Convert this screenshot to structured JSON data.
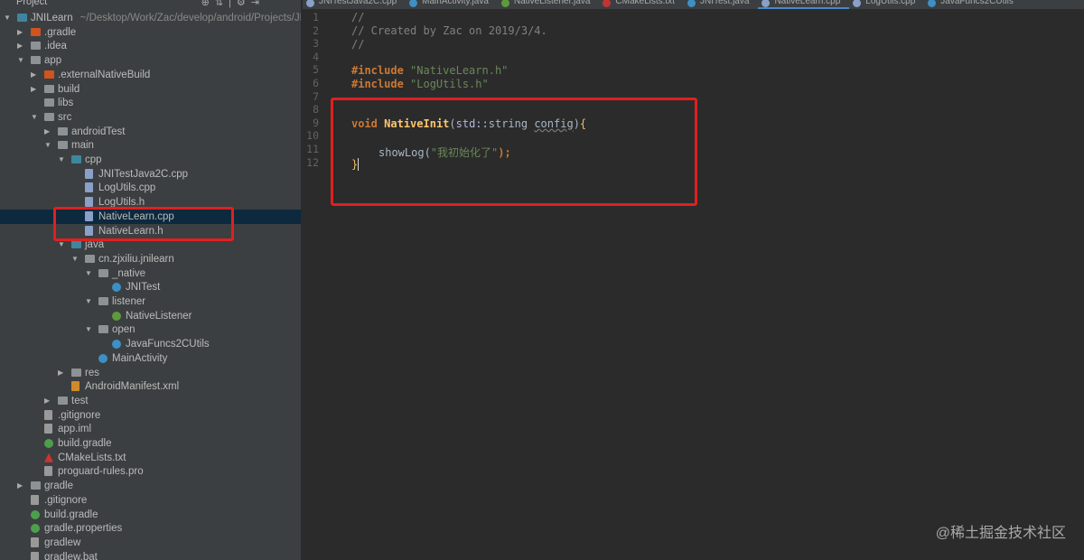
{
  "sidebar": {
    "title": "Project",
    "tree": [
      {
        "label": "JNILearn",
        "path": "~/Desktop/Work/Zac/develop/android/Projects/JN",
        "level": 0,
        "arrow": "down",
        "icon": "module"
      },
      {
        "label": ".gradle",
        "level": 1,
        "arrow": "right",
        "icon": "folder-orange"
      },
      {
        "label": ".idea",
        "level": 1,
        "arrow": "right",
        "icon": "folder"
      },
      {
        "label": "app",
        "level": 1,
        "arrow": "down",
        "icon": "folder"
      },
      {
        "label": ".externalNativeBuild",
        "level": 2,
        "arrow": "right",
        "icon": "folder-orange"
      },
      {
        "label": "build",
        "level": 2,
        "arrow": "right",
        "icon": "folder"
      },
      {
        "label": "libs",
        "level": 2,
        "arrow": "",
        "icon": "folder"
      },
      {
        "label": "src",
        "level": 2,
        "arrow": "down",
        "icon": "folder"
      },
      {
        "label": "androidTest",
        "level": 3,
        "arrow": "right",
        "icon": "folder"
      },
      {
        "label": "main",
        "level": 3,
        "arrow": "down",
        "icon": "folder"
      },
      {
        "label": "cpp",
        "level": 4,
        "arrow": "down",
        "icon": "folder-blue"
      },
      {
        "label": "JNITestJava2C.cpp",
        "level": 5,
        "arrow": "",
        "icon": "file"
      },
      {
        "label": "LogUtils.cpp",
        "level": 5,
        "arrow": "",
        "icon": "file"
      },
      {
        "label": "LogUtils.h",
        "level": 5,
        "arrow": "",
        "icon": "file"
      },
      {
        "label": "NativeLearn.cpp",
        "level": 5,
        "arrow": "",
        "icon": "file",
        "selected": true
      },
      {
        "label": "NativeLearn.h",
        "level": 5,
        "arrow": "",
        "icon": "file"
      },
      {
        "label": "java",
        "level": 4,
        "arrow": "down",
        "icon": "folder-blue"
      },
      {
        "label": "cn.zjxiliu.jnilearn",
        "level": 5,
        "arrow": "down",
        "icon": "folder"
      },
      {
        "label": "_native",
        "level": 6,
        "arrow": "down",
        "icon": "folder"
      },
      {
        "label": "JNITest",
        "level": 7,
        "arrow": "",
        "icon": "class"
      },
      {
        "label": "listener",
        "level": 6,
        "arrow": "down",
        "icon": "folder"
      },
      {
        "label": "NativeListener",
        "level": 7,
        "arrow": "",
        "icon": "interface"
      },
      {
        "label": "open",
        "level": 6,
        "arrow": "down",
        "icon": "folder"
      },
      {
        "label": "JavaFuncs2CUtils",
        "level": 7,
        "arrow": "",
        "icon": "class"
      },
      {
        "label": "MainActivity",
        "level": 6,
        "arrow": "",
        "icon": "class"
      },
      {
        "label": "res",
        "level": 4,
        "arrow": "right",
        "icon": "folder"
      },
      {
        "label": "AndroidManifest.xml",
        "level": 4,
        "arrow": "",
        "icon": "xml"
      },
      {
        "label": "test",
        "level": 3,
        "arrow": "right",
        "icon": "folder"
      },
      {
        "label": ".gitignore",
        "level": 2,
        "arrow": "",
        "icon": "text"
      },
      {
        "label": "app.iml",
        "level": 2,
        "arrow": "",
        "icon": "text"
      },
      {
        "label": "build.gradle",
        "level": 2,
        "arrow": "",
        "icon": "gradle"
      },
      {
        "label": "CMakeLists.txt",
        "level": 2,
        "arrow": "",
        "icon": "cmake"
      },
      {
        "label": "proguard-rules.pro",
        "level": 2,
        "arrow": "",
        "icon": "text"
      },
      {
        "label": "gradle",
        "level": 1,
        "arrow": "right",
        "icon": "folder"
      },
      {
        "label": ".gitignore",
        "level": 1,
        "arrow": "",
        "icon": "text"
      },
      {
        "label": "build.gradle",
        "level": 1,
        "arrow": "",
        "icon": "gradle"
      },
      {
        "label": "gradle.properties",
        "level": 1,
        "arrow": "",
        "icon": "gradle"
      },
      {
        "label": "gradlew",
        "level": 1,
        "arrow": "",
        "icon": "text"
      },
      {
        "label": "gradlew.bat",
        "level": 1,
        "arrow": "",
        "icon": "text"
      }
    ]
  },
  "tabs": [
    {
      "label": "JNITestJava2C.cpp",
      "icon": "file",
      "color": "#8aa0c8"
    },
    {
      "label": "MainActivity.java",
      "icon": "class",
      "color": "#3d8fc4"
    },
    {
      "label": "NativeListener.java",
      "icon": "interface",
      "color": "#5d9b3a"
    },
    {
      "label": "CMakeLists.txt",
      "icon": "cmake",
      "color": "#c33333"
    },
    {
      "label": "JNITest.java",
      "icon": "class",
      "color": "#3d8fc4"
    },
    {
      "label": "NativeLearn.cpp",
      "icon": "file",
      "color": "#8aa0c8",
      "active": true
    },
    {
      "label": "LogUtils.cpp",
      "icon": "file",
      "color": "#8aa0c8"
    },
    {
      "label": "JavaFuncs2CUtils",
      "icon": "class",
      "color": "#3d8fc4"
    }
  ],
  "editor": {
    "line_numbers": [
      "1",
      "2",
      "3",
      "4",
      "5",
      "6",
      "7",
      "8",
      "9",
      "10",
      "11",
      "12"
    ],
    "l1": "//",
    "l2": "// Created by Zac on 2019/3/4.",
    "l3": "//",
    "inc": "#include",
    "inc1": "\"NativeLearn.h\"",
    "inc2": "\"LogUtils.h\"",
    "void": "void",
    "fname": "NativeInit",
    "paren_open": "(",
    "ns": "std::",
    "type": "string ",
    "param": "config",
    "paren_close": ")",
    "brace_open": "{",
    "call": "showLog(",
    "call_str": "\"我初始化了\"",
    "call_end": ");",
    "brace_close": "}"
  },
  "watermark": "@稀土掘金技术社区"
}
